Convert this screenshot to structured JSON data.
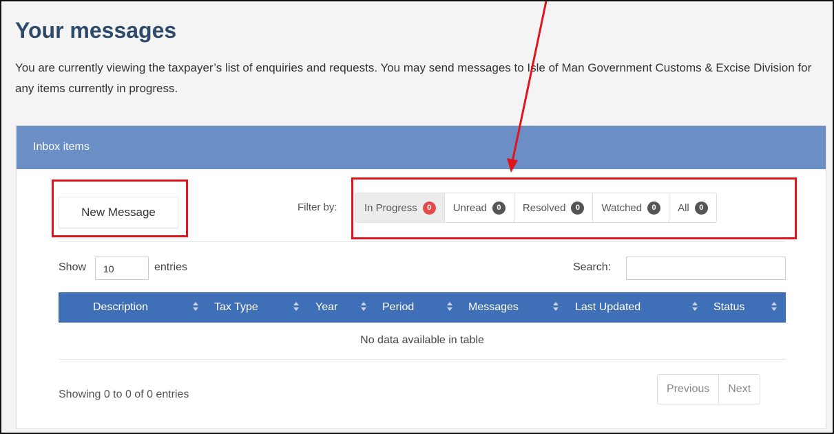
{
  "page": {
    "title": "Your messages",
    "intro": "You are currently viewing the taxpayer’s list of enquiries and requests. You may send messages to Isle of Man Government Customs & Excise Division for any items currently in progress."
  },
  "panel": {
    "heading": "Inbox items",
    "new_message_label": "New Message",
    "filter_label": "Filter by:",
    "filters": [
      {
        "label": "In Progress",
        "count": "0"
      },
      {
        "label": "Unread",
        "count": "0"
      },
      {
        "label": "Resolved",
        "count": "0"
      },
      {
        "label": "Watched",
        "count": "0"
      },
      {
        "label": "All",
        "count": "0"
      }
    ]
  },
  "table": {
    "show_label": "Show",
    "page_length": "10",
    "entries_label": "entries",
    "search_label": "Search:",
    "search_value": "",
    "columns": [
      "Description",
      "Tax Type",
      "Year",
      "Period",
      "Messages",
      "Last Updated",
      "Status"
    ],
    "empty_text": "No data available in table",
    "info": "Showing 0 to 0 of 0 entries",
    "prev_label": "Previous",
    "next_label": "Next"
  },
  "colors": {
    "panel_heading": "#6b8fc5",
    "table_header": "#3f6fb6",
    "highlight_box": "#e0141b",
    "badge_active": "#e64b4b",
    "badge_default": "#555555"
  }
}
